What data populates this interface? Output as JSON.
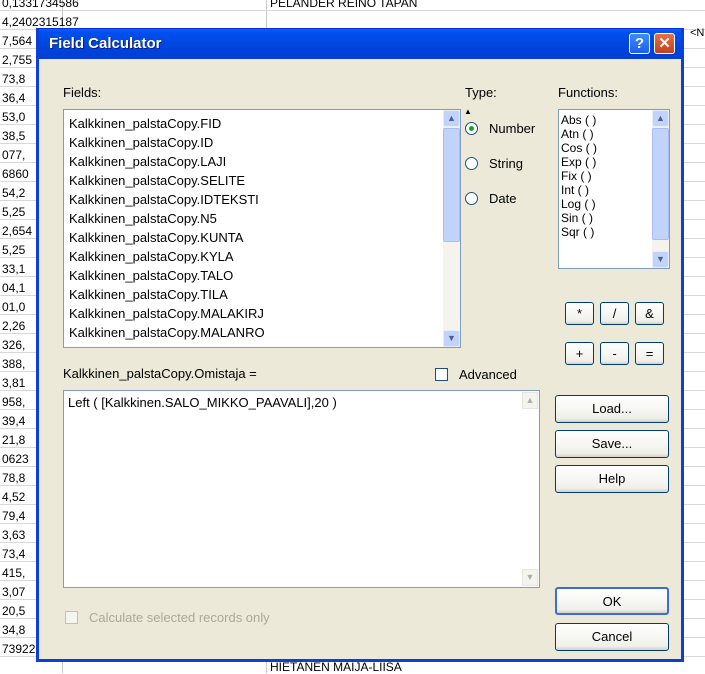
{
  "background": {
    "left_cells": [
      "0,1331734586",
      "4,2402315187",
      "7,564",
      "2,755",
      "73,8",
      "36,4",
      "53,0",
      "38,5",
      "077,",
      "6860",
      "54,2",
      "5,25",
      "2,654",
      "5,25",
      "33,1",
      "04,1",
      "01,0",
      "2,26",
      "326,",
      "388,",
      "3,81",
      "958,",
      "39,4",
      "21,8",
      "0623",
      "78,8",
      "4,52",
      "79,4",
      "3,63",
      "73,4",
      "415,",
      "3,07",
      "20,5",
      "34,8",
      "7392253037"
    ],
    "top_name": "PELANDER REINO TAPAN",
    "bottom_name": "HIETANEN MAIJA-LIISA",
    "right_mark": "<N"
  },
  "dialog": {
    "title": "Field Calculator",
    "help_label": "?",
    "close_label": "✕",
    "fields_label": "Fields:",
    "fields": [
      "Kalkkinen_palstaCopy.FID",
      "Kalkkinen_palstaCopy.ID",
      "Kalkkinen_palstaCopy.LAJI",
      "Kalkkinen_palstaCopy.SELITE",
      "Kalkkinen_palstaCopy.IDTEKSTI",
      "Kalkkinen_palstaCopy.N5",
      "Kalkkinen_palstaCopy.KUNTA",
      "Kalkkinen_palstaCopy.KYLA",
      "Kalkkinen_palstaCopy.TALO",
      "Kalkkinen_palstaCopy.TILA",
      "Kalkkinen_palstaCopy.MALAKIRJ",
      "Kalkkinen_palstaCopy.MALANRO"
    ],
    "type_label": "Type:",
    "types": [
      {
        "label": "Number",
        "selected": true
      },
      {
        "label": "String",
        "selected": false
      },
      {
        "label": "Date",
        "selected": false
      }
    ],
    "functions_label": "Functions:",
    "functions": [
      "Abs ( )",
      "Atn ( )",
      "Cos ( )",
      "Exp ( )",
      "Fix ( )",
      "Int ( )",
      "Log ( )",
      "Sin ( )",
      "Sqr ( )"
    ],
    "operators": [
      "*",
      "/",
      "&",
      "+",
      "-",
      "="
    ],
    "expression_label": "Kalkkinen_palstaCopy.Omistaja =",
    "advanced_label": "Advanced",
    "expression": "Left ( [Kalkkinen.SALO_MIKKO_PAAVALI],20 )",
    "load_label": "Load...",
    "save_label": "Save...",
    "help_button_label": "Help",
    "ok_label": "OK",
    "cancel_label": "Cancel",
    "calc_selected_label": "Calculate selected records only"
  },
  "colors": {
    "titlebar": "#0046e0",
    "dialog_bg": "#ece9d8",
    "selected_radio": "#21a121"
  }
}
